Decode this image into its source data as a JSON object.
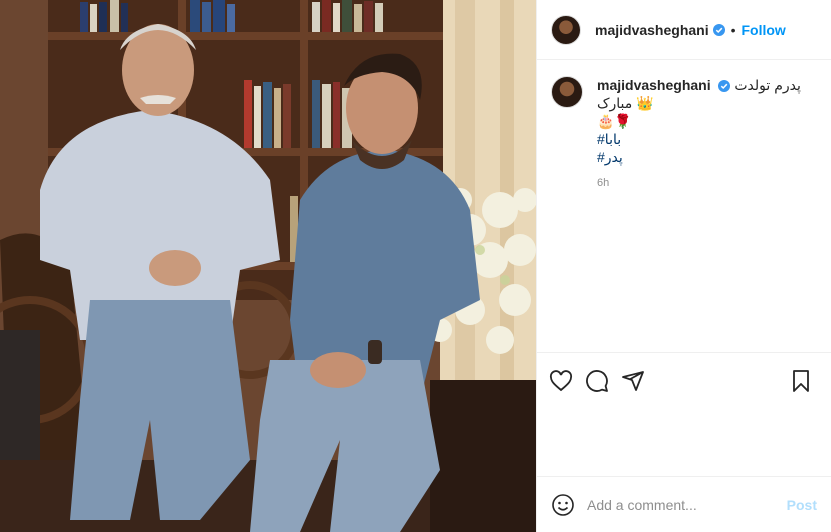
{
  "post": {
    "username": "majidvasheghani",
    "follow_label": "Follow",
    "separator": "•",
    "caption_line1": "پدرم تولدت مبارک 👑",
    "caption_line2": "🎂🌹",
    "hashtags": [
      "#بابا",
      "#پدر"
    ],
    "timestamp": "6h",
    "verified_icon": "verified-badge-icon"
  },
  "actions": {
    "like_icon": "heart-icon",
    "comment_icon": "comment-icon",
    "share_icon": "share-icon",
    "save_icon": "bookmark-icon"
  },
  "comment_box": {
    "placeholder": "Add a comment...",
    "post_label": "Post"
  },
  "colors": {
    "link_blue": "#0095f6",
    "hashtag": "#00376b",
    "muted": "#8e8e8e",
    "post_disabled": "#b2dffc"
  }
}
